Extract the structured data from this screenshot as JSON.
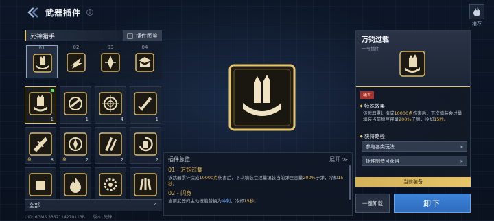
{
  "header": {
    "title": "武器插件",
    "info_icon": "i"
  },
  "recommend": {
    "label": "推荐",
    "icon": "flame-icon"
  },
  "set": {
    "name": "死神猎手",
    "atlas_label": "插件图鉴",
    "slots": [
      "01",
      "02",
      "03",
      "04"
    ]
  },
  "inventory": [
    {
      "count": "1",
      "selected": true,
      "new": true
    },
    {
      "count": "1"
    },
    {
      "count": "4"
    },
    {
      "count": "1"
    },
    {
      "count": "8",
      "locked": true
    },
    {
      "count": "2",
      "locked": true
    },
    {
      "count": "2"
    },
    {
      "count": "2"
    },
    {
      "count": "",
      "locked": false
    },
    {
      "count": ""
    },
    {
      "count": ""
    },
    {
      "count": ""
    }
  ],
  "filter": {
    "label": "全部",
    "icon": "chevron-up-icon"
  },
  "footer": {
    "uid": "UID: 6GMS  3352114270113B",
    "edition": "版本: 先锋"
  },
  "summary": {
    "title": "插件总览",
    "expand": "展开",
    "items": [
      {
        "title": "01 - 万钧过载",
        "desc_a": "该武器累计造成",
        "desc_hl1": "10000点",
        "desc_b": "伤害后，下次填装会过量填装当前弹匣容量",
        "desc_hl2": "200%",
        "desc_c": "子弹，冷却",
        "desc_hl3": "15秒",
        "desc_d": "。"
      },
      {
        "title": "02 - 闪身",
        "desc_a": "当前武器的主动技能替换为",
        "desc_hl1": "冲刺",
        "desc_b": "，冷却",
        "desc_hl2": "15秒",
        "desc_c": "。",
        "desc_hl3": "",
        "desc_d": ""
      }
    ]
  },
  "detail": {
    "title": "万钧过载",
    "sub": "一号插件",
    "rarity": "稀有",
    "effect_heading": "特殊效果",
    "effect_a": "该武器累计造成",
    "effect_hl1": "10000点",
    "effect_b": "伤害后，下次填装会过量填装当前弹匣容量",
    "effect_hl2": "200%",
    "effect_c": "子弹，冷却",
    "effect_hl3": "15秒",
    "effect_d": "。",
    "route_heading": "获得路径",
    "routes": [
      "参与各类玩法",
      "插件制造可获得"
    ]
  },
  "equipped_label": "当前装备",
  "buttons": {
    "unequip_all": "一键卸载",
    "unload": "卸下"
  },
  "colors": {
    "gold": "#e5c56a",
    "accent_blue": "#2f6cbe",
    "highlight": "#e9b84f"
  }
}
